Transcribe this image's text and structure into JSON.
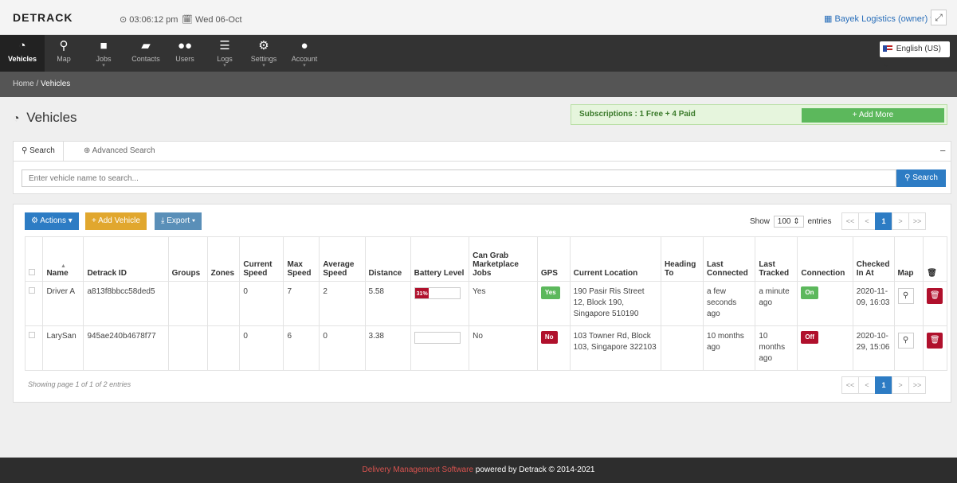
{
  "topbar": {
    "logo_text": "DETRACK",
    "time": "⊙ 03:06:12 pm",
    "date": "🗓 Wed 06-Oct",
    "company": "Bayek Logistics (owner)",
    "fullscreen_icon": "expand-icon"
  },
  "nav": {
    "items": [
      {
        "label": "Vehicles",
        "icon": "dashboard-icon"
      },
      {
        "label": "Map",
        "icon": "map-marker-icon"
      },
      {
        "label": "Jobs",
        "icon": "briefcase-icon"
      },
      {
        "label": "Contacts",
        "icon": "book-icon"
      },
      {
        "label": "Users",
        "icon": "users-icon"
      },
      {
        "label": "Logs",
        "icon": "list-icon"
      },
      {
        "label": "Settings",
        "icon": "gear-icon"
      },
      {
        "label": "Account",
        "icon": "user-icon"
      }
    ],
    "language": "English (US)"
  },
  "breadcrumb": {
    "home": "Home",
    "separator": "/",
    "current": "Vehicles"
  },
  "page": {
    "title": "Vehicles"
  },
  "subscriptions": {
    "text": "Subscriptions : 1 Free + 4 Paid",
    "add_more": "Add More"
  },
  "search": {
    "tab_search": "Search",
    "tab_advanced": "Advanced Search",
    "placeholder": "Enter vehicle name to search...",
    "button": "Search"
  },
  "toolbar": {
    "actions": "Actions",
    "add_vehicle": "Add Vehicle",
    "export": "Export",
    "show": "Show",
    "entries_value": "100",
    "entries": "entries"
  },
  "pager": {
    "first": "<<",
    "prev": "<",
    "current": "1",
    "next": ">",
    "last": ">>"
  },
  "table": {
    "headers": {
      "name": "Name",
      "detrack_id": "Detrack ID",
      "groups": "Groups",
      "zones": "Zones",
      "current_speed": "Current Speed",
      "max_speed": "Max Speed",
      "average_speed": "Average Speed",
      "distance": "Distance",
      "battery_level": "Battery Level",
      "marketplace": "Can Grab Marketplace Jobs",
      "gps": "GPS",
      "current_location": "Current Location",
      "heading_to": "Heading To",
      "last_connected": "Last Connected",
      "last_tracked": "Last Tracked",
      "connection": "Connection",
      "checked_in_at": "Checked In At",
      "map": "Map"
    },
    "rows": [
      {
        "name": "Driver A",
        "detrack_id": "a813f8bbcc58ded5",
        "groups": "",
        "zones": "",
        "current_speed": "0",
        "max_speed": "7",
        "average_speed": "2",
        "distance": "5.58",
        "battery_label": "31%",
        "battery_fraction": 0.31,
        "marketplace": "Yes",
        "gps": "Yes",
        "current_location": "190 Pasir Ris Street 12, Block 190, Singapore 510190",
        "heading_to": "",
        "last_connected": "a few seconds ago",
        "last_tracked": "a minute ago",
        "connection": "On",
        "checked_in_at": "2020-11-09, 16:03"
      },
      {
        "name": "LarySan",
        "detrack_id": "945ae240b4678f77",
        "groups": "",
        "zones": "",
        "current_speed": "0",
        "max_speed": "6",
        "average_speed": "0",
        "distance": "3.38",
        "battery_label": "",
        "battery_fraction": 0,
        "marketplace": "No",
        "gps": "No",
        "current_location": "103 Towner Rd, Block 103, Singapore 322103",
        "heading_to": "",
        "last_connected": "10 months ago",
        "last_tracked": "10 months ago",
        "connection": "Off",
        "checked_in_at": "2020-10-29, 15:06"
      }
    ],
    "summary": "Showing page 1 of 1 of 2 entries"
  },
  "footer": {
    "link": "Delivery Management Software",
    "text": " powered by Detrack © 2014-2021"
  },
  "colors": {
    "primary": "#2d7cc4",
    "success": "#5cb85c",
    "danger": "#b0102c",
    "warning": "#e1a72e"
  }
}
